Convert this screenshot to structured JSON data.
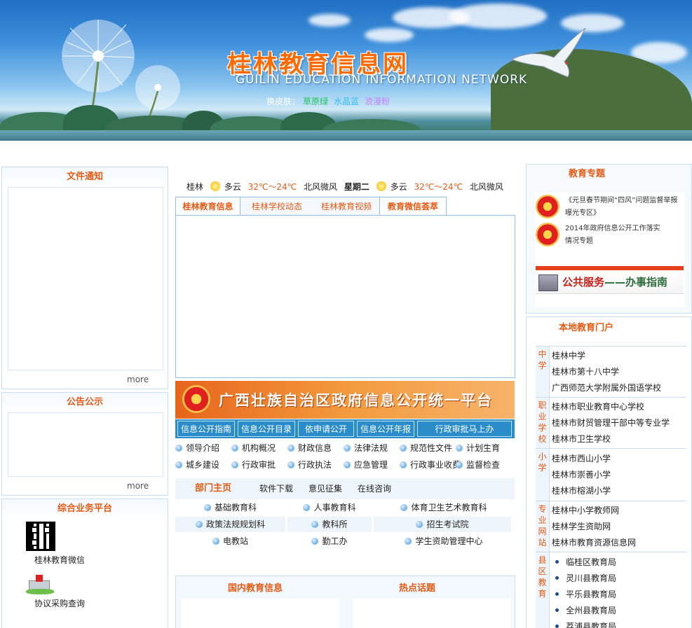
{
  "banner": {
    "title": "桂林教育信息网",
    "subtitle": "GUILIN EDUCATION INFORMATION NETWORK",
    "skin_label": "换皮肤：",
    "skins": [
      "草原绿",
      "水晶蓝",
      "浪漫粉"
    ]
  },
  "left": {
    "notice_title": "文件通知",
    "notice_more": "more",
    "announce_title": "公告公示",
    "announce_more": "more",
    "platform_title": "综合业务平台",
    "platform_items": [
      "桂林教育微信",
      "协议采购查询"
    ]
  },
  "weather": {
    "city": "桂林",
    "today": {
      "cond": "多云",
      "temp": "32℃～24℃",
      "wind": "北风微风"
    },
    "weekday": "星期二",
    "tomorrow": {
      "cond": "多云",
      "temp": "32℃～24℃",
      "wind": "北风微风"
    }
  },
  "tabs": [
    "桂林教育信息",
    "桂林学校动态",
    "桂林教育视频",
    "教育微信荟萃"
  ],
  "gov_platform": {
    "title": "广西壮族自治区政府信息公开统一平台",
    "links": [
      "信息公开指南",
      "信息公开目录",
      "依申请公开",
      "信息公开年报",
      "行政审批马上办"
    ]
  },
  "categories": [
    [
      "领导介绍",
      "机构概况",
      "财政信息",
      "法律法规",
      "规范性文件",
      "计划生育"
    ],
    [
      "城乡建设",
      "行政审批",
      "行政执法",
      "应急管理",
      "行政事业收费",
      "监督检查"
    ]
  ],
  "dept": {
    "title": "部门主页",
    "links": [
      "软件下载",
      "意见征集",
      "在线咨询"
    ],
    "rows": [
      [
        "基础教育科",
        "人事教育科",
        "体育卫生艺术教育科"
      ],
      [
        "政策法规规划科",
        "教科所",
        "招生考试院"
      ],
      [
        "电教站",
        "勤工办",
        "学生资助管理中心"
      ]
    ]
  },
  "bottom": {
    "domestic_title": "国内教育信息",
    "hot_title": "热点话题"
  },
  "right": {
    "topics_title": "教育专题",
    "topics": [
      "《元旦春节期间“四风”问题监督举报曝光专区》",
      "2014年政府信息公开工作落实情况专题"
    ],
    "service_title": "公共服务",
    "service_sub": "——办事指南",
    "portal_title": "本地教育门户",
    "groups": [
      {
        "tag": "中学",
        "items": [
          "桂林中学",
          "桂林市第十八中学",
          "广西师范大学附属外国语学校"
        ]
      },
      {
        "tag": "职业学校",
        "items": [
          "桂林市职业教育中心学校",
          "桂林市财贸管理干部中等专业学",
          "桂林市卫生学校"
        ]
      },
      {
        "tag": "小学",
        "items": [
          "桂林市西山小学",
          "桂林市崇善小学",
          "桂林市榕湖小学"
        ]
      },
      {
        "tag": "专业网站",
        "items": [
          "桂林中小学教师网",
          "桂林学生资助网",
          "桂林市教育资源信息网"
        ]
      },
      {
        "tag": "县区教育",
        "items": [
          "临桂区教育局",
          "灵川县教育局",
          "平乐县教育局",
          "全州县教育局",
          "荔浦县教育局"
        ]
      }
    ]
  }
}
